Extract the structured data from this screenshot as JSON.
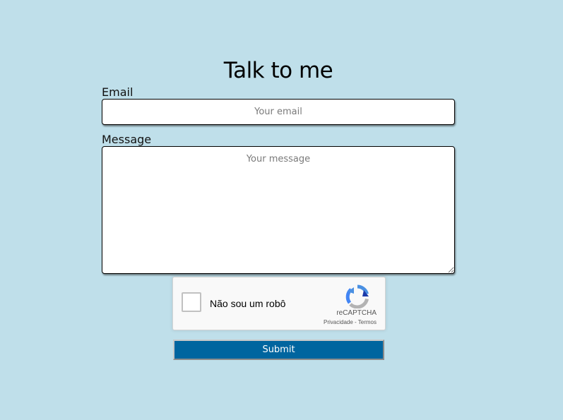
{
  "page": {
    "background_color": "#bfdfea"
  },
  "form": {
    "title": "Talk to me",
    "email": {
      "label": "Email",
      "placeholder": "Your email",
      "value": ""
    },
    "message": {
      "label": "Message",
      "placeholder": "Your message",
      "value": ""
    },
    "submit_label": "Submit",
    "submit_color": "#00659f"
  },
  "captcha": {
    "checkbox_label": "Não sou um robô",
    "brand": "reCAPTCHA",
    "privacy_link": "Privacidade",
    "separator": " - ",
    "terms_link": "Termos",
    "logo_icon": "recaptcha-logo-icon"
  }
}
